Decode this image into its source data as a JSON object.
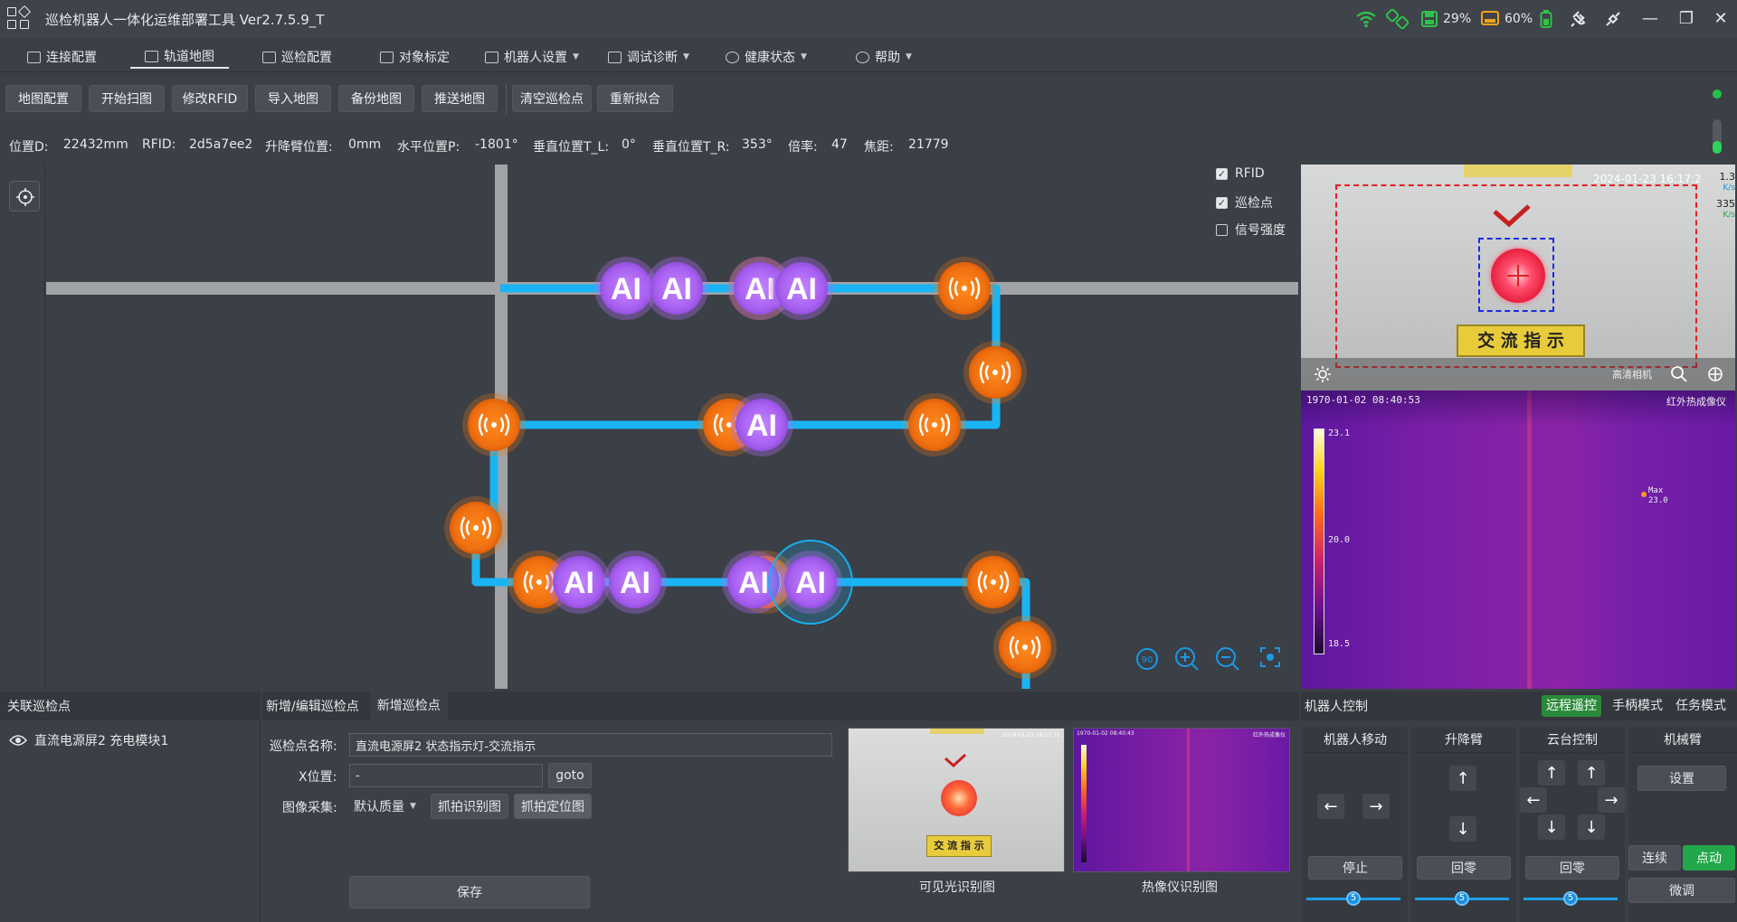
{
  "app": {
    "title": "巡检机器人一体化运维部署工具  Ver2.7.5.9_T"
  },
  "status": {
    "battery_pct": "29%",
    "cpu_pct": "60%"
  },
  "menu": [
    {
      "label": "连接配置"
    },
    {
      "label": "轨道地图"
    },
    {
      "label": "巡检配置"
    },
    {
      "label": "对象标定"
    },
    {
      "label": "机器人设置"
    },
    {
      "label": "调试诊断"
    },
    {
      "label": "健康状态"
    },
    {
      "label": "帮助"
    }
  ],
  "toolbar": [
    {
      "label": "地图配置"
    },
    {
      "label": "开始扫图"
    },
    {
      "label": "修改RFID"
    },
    {
      "label": "导入地图"
    },
    {
      "label": "备份地图"
    },
    {
      "label": "推送地图"
    },
    {
      "label": "清空巡检点"
    },
    {
      "label": "重新拟合"
    }
  ],
  "info": {
    "position_d_label": "位置D:",
    "position_d": "22432mm",
    "rfid_label": "RFID:",
    "rfid": "2d5a7ee2",
    "lift_label": "升降臂位置:",
    "lift": "0mm",
    "hpos_label": "水平位置P:",
    "hpos": "-1801°",
    "vpos_l_label": "垂直位置T_L:",
    "vpos_l": "0°",
    "vpos_r_label": "垂直位置T_R:",
    "vpos_r": "353°",
    "zoom_label": "倍率:",
    "zoom": "47",
    "focus_label": "焦距:",
    "focus": "21779"
  },
  "map": {
    "checks": [
      {
        "label": "RFID",
        "checked": true
      },
      {
        "label": "巡检点",
        "checked": true
      },
      {
        "label": "信号强度",
        "checked": false
      }
    ],
    "ai_label": "AI"
  },
  "camera": {
    "visible_timestamp": "2024-01-23 16:17:2",
    "visible_sign": "交 流 指 示",
    "visible_caption": "高清相机",
    "speed_up": "1.3",
    "speed_up_unit": "K/s",
    "speed_down": "335",
    "speed_down_unit": "K/s",
    "ir_timestamp": "1970-01-02 08:40:53",
    "ir_title": "红外热成像仪",
    "ir_scale": [
      "23.1",
      "20.0",
      "18.5"
    ],
    "ir_max_label": "Max",
    "ir_max_value": "23.0"
  },
  "bottom": {
    "related_title": "关联巡检点",
    "related_items": [
      {
        "label": "直流电源屏2  充电模块1"
      }
    ],
    "tabs": [
      {
        "label": "新增/编辑巡检点"
      },
      {
        "label": "新增巡检点"
      }
    ],
    "name_label": "巡检点名称:",
    "name_value": "直流电源屏2 状态指示灯-交流指示",
    "x_label": "X位置:",
    "x_value": "-",
    "goto_label": "goto",
    "capture_label": "图像采集:",
    "quality_value": "默认质量",
    "snap_recog_label": "抓拍识别图",
    "snap_locate_label": "抓拍定位图",
    "save_label": "保存",
    "thumb_visible_caption": "可见光识别图",
    "thumb_ir_caption": "热像仪识别图",
    "thumb_visible_sign": "交 流 指 示",
    "thumb_visible_ts": "2024-01-23 16:17:11",
    "thumb_ir_ts": "1970-01-02 08:40:43",
    "thumb_ir_title": "红外热成像仪"
  },
  "robot": {
    "title": "机器人控制",
    "modes": [
      {
        "label": "远程遥控"
      },
      {
        "label": "手柄模式"
      },
      {
        "label": "任务模式"
      }
    ],
    "move_title": "机器人移动",
    "lift_title": "升降臂",
    "ptz_title": "云台控制",
    "arm_title": "机械臂",
    "stop_label": "停止",
    "zero_label": "回零",
    "ptz_zero_label": "回零",
    "arm_settings_label": "设置",
    "continuous_label": "连续",
    "jog_label": "点动",
    "fine_label": "微调",
    "speed_values": [
      "5",
      "5",
      "5"
    ]
  },
  "colors": {
    "accent": "#1aa0e8",
    "orange": "#f07b12",
    "purple": "#b06cf0",
    "green": "#22a84a"
  }
}
